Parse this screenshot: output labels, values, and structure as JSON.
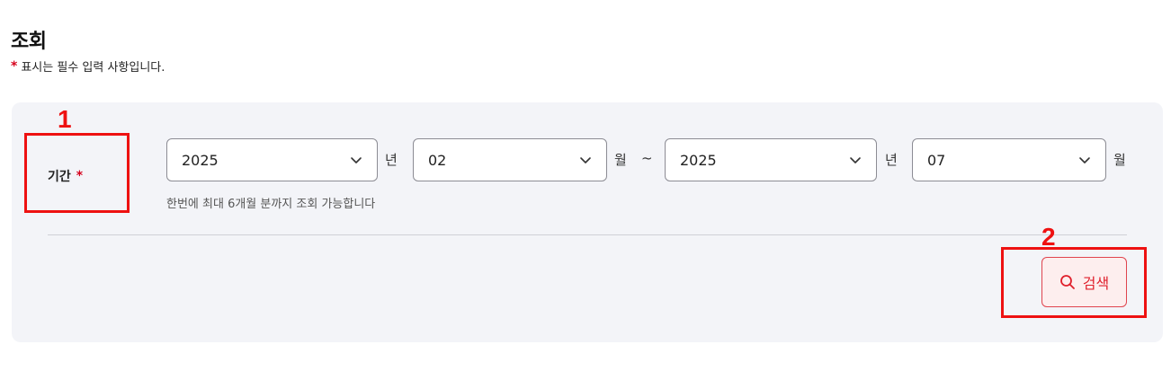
{
  "header": {
    "title": "조회",
    "required_mark": "*",
    "required_note": "표시는 필수 입력 사항입니다."
  },
  "period": {
    "label": "기간",
    "required_mark": "*",
    "from_year": {
      "value": "2025",
      "unit": "년"
    },
    "from_month": {
      "value": "02",
      "unit": "월"
    },
    "separator": "~",
    "to_year": {
      "value": "2025",
      "unit": "년"
    },
    "to_month": {
      "value": "07",
      "unit": "월"
    },
    "helper_text": "한번에 최대 6개월 분까지 조회 가능합니다"
  },
  "actions": {
    "search_label": "검색"
  },
  "annotations": {
    "one": "1",
    "two": "2"
  },
  "colors": {
    "accent": "#e0202c",
    "annotation": "#ee1111",
    "panel_bg": "#f3f4f8"
  },
  "icons": {
    "dropdown": "chevron-down-icon",
    "search": "search-icon"
  }
}
